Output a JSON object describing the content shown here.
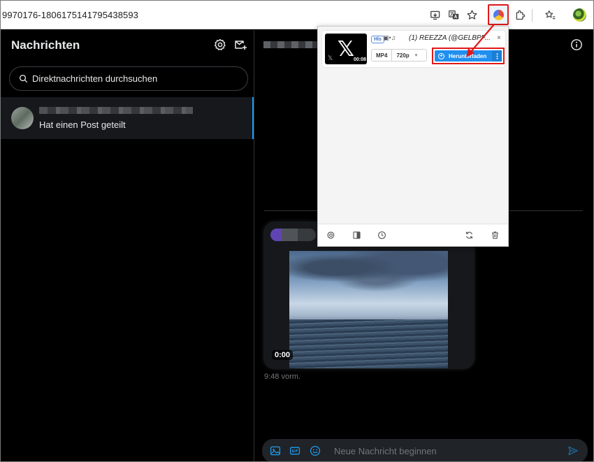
{
  "browser": {
    "url": "9970176-1806175141795438593"
  },
  "left_panel": {
    "title": "Nachrichten",
    "search_placeholder": "Direktnachrichten durchsuchen",
    "conversation": {
      "preview": "Hat einen Post geteilt"
    }
  },
  "chat": {
    "video_time": "0:00",
    "message_time": "9:48 vorm.",
    "compose_placeholder": "Neue Nachricht beginnen"
  },
  "popup": {
    "badge": "Hls",
    "title": "(1) REEZZA (@GELBPF...",
    "duration": "00:08",
    "format": "MP4",
    "quality": "720p",
    "download_label": "Herunterladen",
    "close_glyph": "×"
  },
  "colors": {
    "accent": "#1d9bf0",
    "download_button": "#1f8ff0",
    "highlight": "#e11919"
  }
}
